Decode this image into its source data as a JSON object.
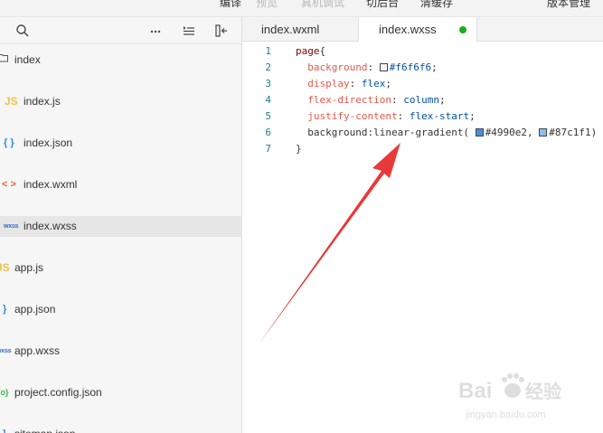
{
  "toolbar": {
    "items": [
      "编译",
      "预览",
      "真机调试",
      "切后台",
      "清缓存",
      "版本管理"
    ]
  },
  "sidebar": {
    "root": "index",
    "files": [
      {
        "icon": "JS",
        "type": "js",
        "name": "index.js",
        "depth": 1
      },
      {
        "icon": "{ }",
        "type": "json",
        "name": "index.json",
        "depth": 1
      },
      {
        "icon": "< >",
        "type": "wxml",
        "name": "index.wxml",
        "depth": 1
      },
      {
        "icon": "wxss",
        "type": "wxss",
        "name": "index.wxss",
        "depth": 1,
        "selected": true
      },
      {
        "icon": "JS",
        "type": "js",
        "name": "app.js",
        "depth": 0
      },
      {
        "icon": "}",
        "type": "json",
        "name": "app.json",
        "depth": 0
      },
      {
        "icon": "wxss",
        "type": "wxss",
        "name": "app.wxss",
        "depth": 0
      },
      {
        "icon": "{o}",
        "type": "cfg",
        "name": "project.config.json",
        "depth": 0
      },
      {
        "icon": "}",
        "type": "json",
        "name": "sitemap.json",
        "depth": 0
      }
    ]
  },
  "tabs": [
    {
      "label": "index.wxml",
      "active": false
    },
    {
      "label": "index.wxss",
      "active": true,
      "modified": true
    }
  ],
  "editor": {
    "lines": [
      {
        "n": "1",
        "tokens": [
          [
            "sel",
            "page"
          ],
          [
            "punc",
            "{"
          ]
        ]
      },
      {
        "n": "2",
        "tokens": [
          [
            "ind",
            "  "
          ],
          [
            "prop",
            "background"
          ],
          [
            "punc",
            ": "
          ],
          [
            "swatch",
            "#f6f6f6"
          ],
          [
            "val",
            "#f6f6f6"
          ],
          [
            "punc",
            ";"
          ]
        ]
      },
      {
        "n": "3",
        "tokens": [
          [
            "ind",
            "  "
          ],
          [
            "prop",
            "display"
          ],
          [
            "punc",
            ": "
          ],
          [
            "val",
            "flex"
          ],
          [
            "punc",
            ";"
          ]
        ]
      },
      {
        "n": "4",
        "tokens": [
          [
            "ind",
            "  "
          ],
          [
            "prop",
            "flex-direction"
          ],
          [
            "punc",
            ": "
          ],
          [
            "val",
            "column"
          ],
          [
            "punc",
            ";"
          ]
        ]
      },
      {
        "n": "5",
        "tokens": [
          [
            "ind",
            "  "
          ],
          [
            "prop",
            "justify-content"
          ],
          [
            "punc",
            ": "
          ],
          [
            "val",
            "flex-start"
          ],
          [
            "punc",
            ";"
          ]
        ]
      },
      {
        "n": "6",
        "tokens": [
          [
            "ind",
            "  "
          ],
          [
            "punc",
            "background:linear-gradient( "
          ],
          [
            "swatch",
            "#4990e2"
          ],
          [
            "punc",
            "#4990e2, "
          ],
          [
            "swatch",
            "#87c1f1"
          ],
          [
            "punc",
            "#87c1f1)"
          ]
        ]
      },
      {
        "n": "7",
        "tokens": [
          [
            "punc",
            "}"
          ]
        ]
      }
    ]
  },
  "watermark": {
    "brand": "Bai",
    "tail": "经验",
    "url": "jingyan.baidu.com"
  },
  "colors": {
    "accent": "#1aad19",
    "arrow": "#e8393a"
  }
}
